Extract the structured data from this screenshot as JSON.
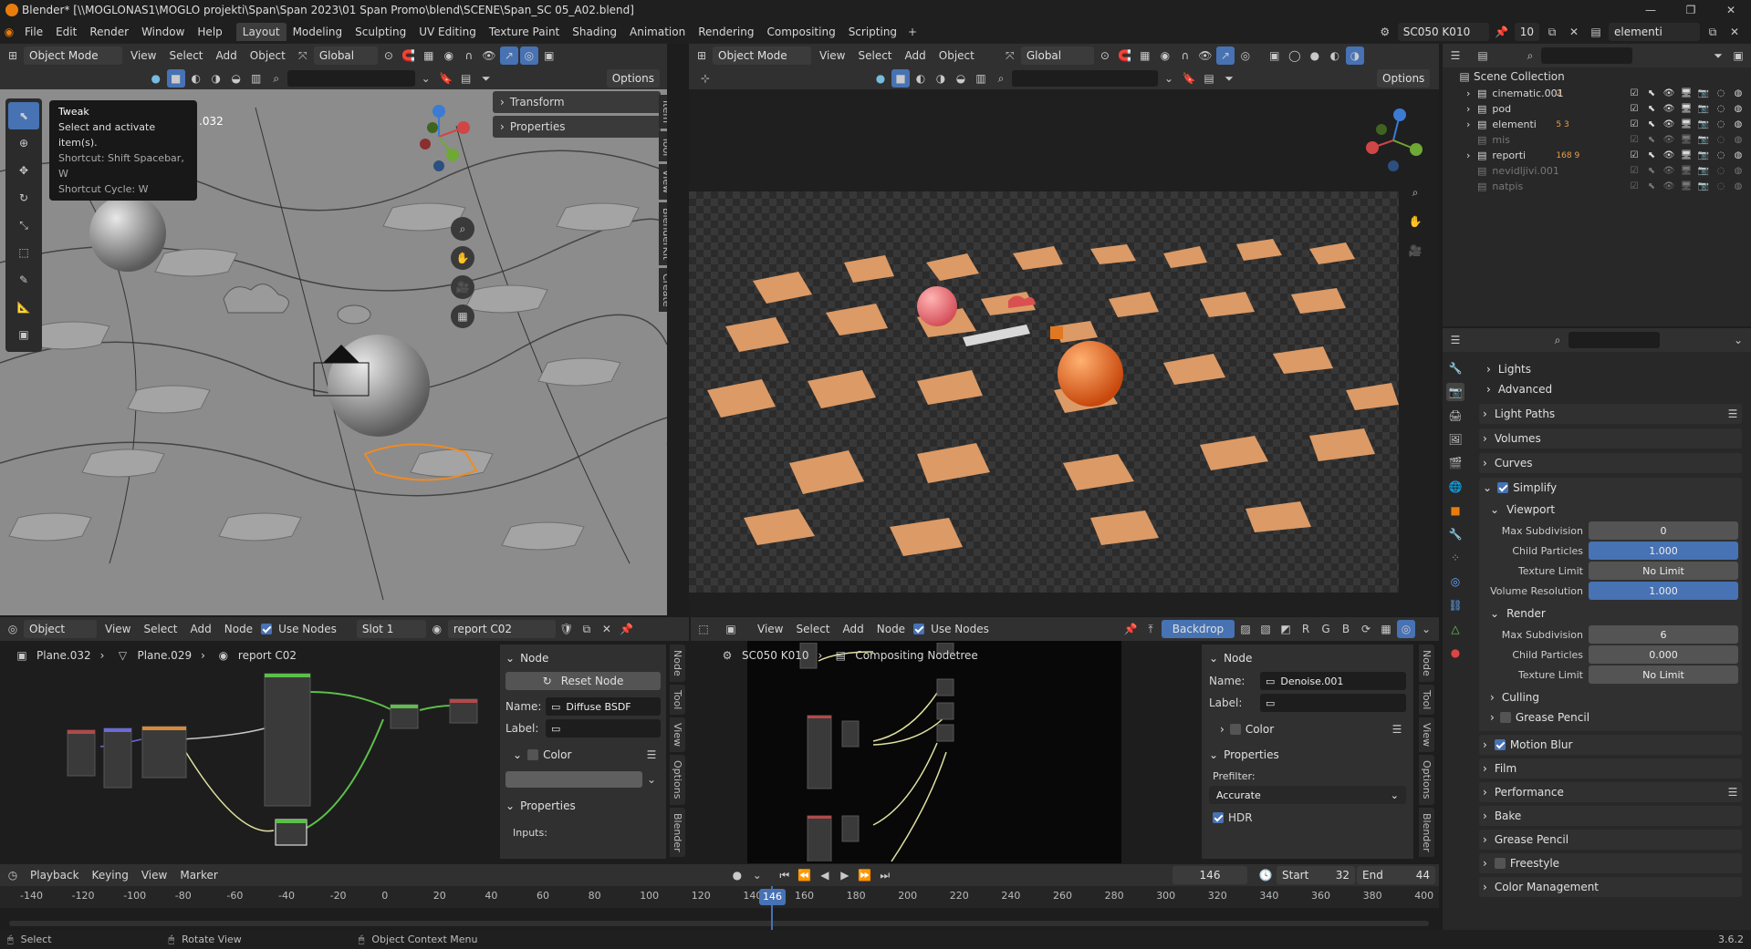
{
  "title": "Blender* [\\\\MOGLONAS1\\MOGLO projekti\\Span\\Span 2023\\01 Span Promo\\blend\\SCENE\\Span_SC 05_A02.blend]",
  "menu": [
    "File",
    "Edit",
    "Render",
    "Window",
    "Help"
  ],
  "workspaces": [
    "Layout",
    "Modeling",
    "Sculpting",
    "UV Editing",
    "Texture Paint",
    "Shading",
    "Animation",
    "Rendering",
    "Compositing",
    "Scripting"
  ],
  "scene": {
    "name": "SC050 K010",
    "frame_count": "10",
    "viewlayer": "elementi"
  },
  "viewport_left": {
    "mode": "Object Mode",
    "menus": [
      "View",
      "Select",
      "Add",
      "Object"
    ],
    "orientation": "Global",
    "options": "Options",
    "object_label": ".032",
    "tooltip": {
      "title": "Tweak",
      "desc": "Select and activate item(s).",
      "shortcut": "Shortcut: Shift Spacebar, W",
      "cycle": "Shortcut Cycle: W"
    },
    "npanel": [
      "Transform",
      "Properties"
    ],
    "tabs": [
      "Item",
      "Tool",
      "View",
      "BlenderKit",
      "Create"
    ]
  },
  "viewport_right": {
    "mode": "Object Mode",
    "menus": [
      "View",
      "Select",
      "Add",
      "Object"
    ],
    "orientation": "Global",
    "options": "Options"
  },
  "outliner": {
    "root": "Scene Collection",
    "items": [
      {
        "name": "cinematic.001",
        "dim": false,
        "extra": "2"
      },
      {
        "name": "pod",
        "dim": false,
        "extra": ""
      },
      {
        "name": "elementi",
        "dim": false,
        "extra": "5 3"
      },
      {
        "name": "mis",
        "dim": true,
        "extra": ""
      },
      {
        "name": "reporti",
        "dim": false,
        "extra": "168 9"
      },
      {
        "name": "nevidljivi.001",
        "dim": true,
        "extra": ""
      },
      {
        "name": "natpis",
        "dim": true,
        "extra": ""
      }
    ]
  },
  "properties": {
    "sections_top": [
      "Lights",
      "Advanced"
    ],
    "light_paths": "Light Paths",
    "volumes": "Volumes",
    "curves": "Curves",
    "simplify": "Simplify",
    "viewport": "Viewport",
    "viewport_fields": [
      {
        "label": "Max Subdivision",
        "value": "0",
        "blue": false
      },
      {
        "label": "Child Particles",
        "value": "1.000",
        "blue": true
      },
      {
        "label": "Texture Limit",
        "value": "No Limit",
        "blue": false
      },
      {
        "label": "Volume Resolution",
        "value": "1.000",
        "blue": true
      }
    ],
    "render": "Render",
    "render_fields": [
      {
        "label": "Max Subdivision",
        "value": "6"
      },
      {
        "label": "Child Particles",
        "value": "0.000"
      },
      {
        "label": "Texture Limit",
        "value": "No Limit"
      }
    ],
    "culling": "Culling",
    "grease_pencil_sub": "Grease Pencil",
    "bottom": [
      "Motion Blur",
      "Film",
      "Performance",
      "Bake",
      "Grease Pencil",
      "Freestyle",
      "Color Management"
    ]
  },
  "shader_editor": {
    "type": "Object",
    "menus": [
      "View",
      "Select",
      "Add",
      "Node"
    ],
    "use_nodes": "Use Nodes",
    "slot": "Slot 1",
    "material": "report C02",
    "breadcrumb": [
      "Plane.032",
      "Plane.029",
      "report C02"
    ],
    "node_panel": {
      "header": "Node",
      "reset": "Reset Node",
      "name_label": "Name:",
      "name_value": "Diffuse BSDF",
      "label_label": "Label:",
      "color": "Color",
      "properties": "Properties",
      "inputs": "Inputs:"
    },
    "tabs": [
      "Node",
      "Tool",
      "View",
      "Options",
      "Blender"
    ]
  },
  "compositor": {
    "menus": [
      "View",
      "Select",
      "Add",
      "Node"
    ],
    "use_nodes": "Use Nodes",
    "backdrop": "Backdrop",
    "breadcrumb": [
      "SC050 K010",
      "Compositing Nodetree"
    ],
    "node_panel": {
      "header": "Node",
      "name_label": "Name:",
      "name_value": "Denoise.001",
      "label_label": "Label:",
      "color": "Color",
      "properties": "Properties",
      "prefilter": "Prefilter:",
      "prefilter_value": "Accurate",
      "hdr": "HDR"
    },
    "tabs": [
      "Node",
      "Tool",
      "View",
      "Options",
      "Blender"
    ]
  },
  "timeline": {
    "menus": [
      "Playback",
      "Keying",
      "View",
      "Marker"
    ],
    "current": "146",
    "start_label": "Start",
    "start": "32",
    "end_label": "End",
    "end": "44",
    "ticks": [
      "-140",
      "-120",
      "-100",
      "-80",
      "-60",
      "-40",
      "-20",
      "0",
      "20",
      "40",
      "60",
      "80",
      "100",
      "120",
      "140",
      "160",
      "180",
      "200",
      "220",
      "240",
      "260",
      "280",
      "300",
      "320",
      "340",
      "360",
      "380",
      "400"
    ]
  },
  "status": {
    "left": "Select",
    "mid": "Rotate View",
    "right": "Object Context Menu",
    "version": "3.6.2"
  }
}
